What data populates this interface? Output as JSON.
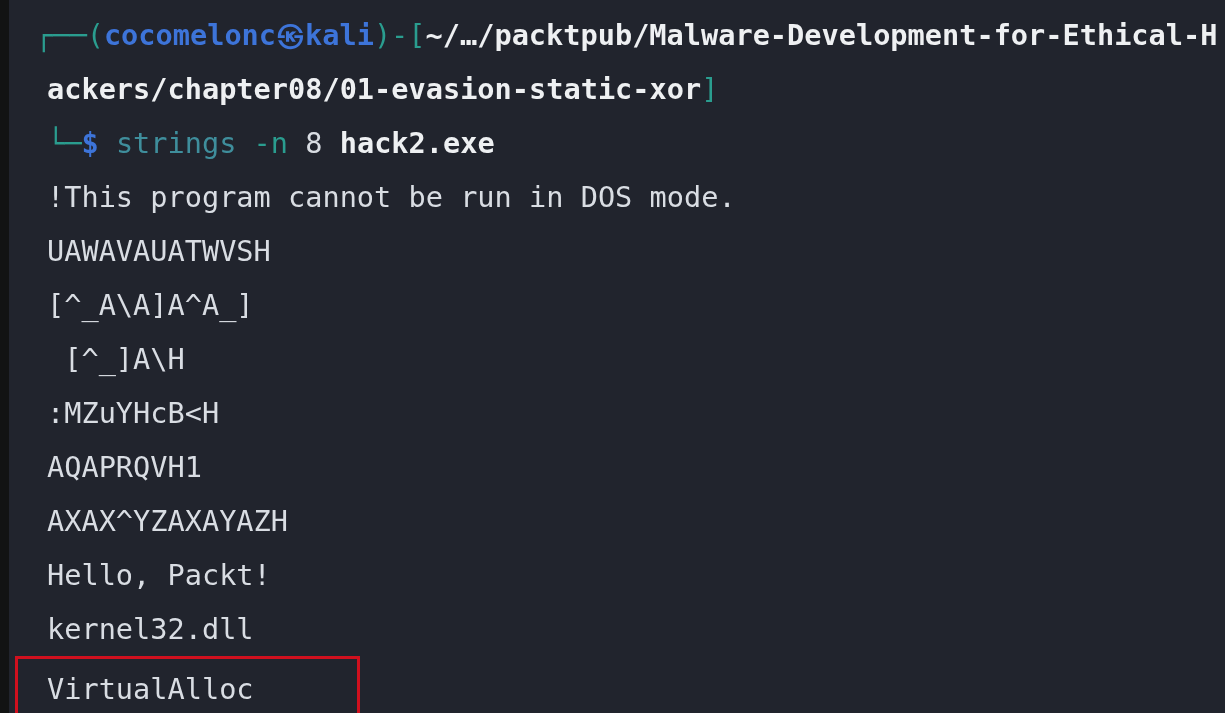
{
  "prompt": {
    "open": "┌──(",
    "user": "cocomelonc",
    "separator": "㉿",
    "host": "kali",
    "mid": ")-[",
    "path": "~/…/packtpub/Malware-Development-for-Ethical-H",
    "path_continued": "ackers/chapter08/01-evasion-static-xor",
    "close": "]"
  },
  "command": {
    "corner": "└─",
    "symbol": "$",
    "program": "strings",
    "flag": "-n",
    "value": "8",
    "argument": "hack2.exe"
  },
  "output": [
    {
      "text": "!This program cannot be run in DOS mode.",
      "highlighted": false
    },
    {
      "text": "UAWAVAUATWVSH",
      "highlighted": false
    },
    {
      "text": "[^_A\\A]A^A_]",
      "highlighted": false
    },
    {
      "text": " [^_]A\\H",
      "highlighted": false
    },
    {
      "text": ":MZuYHcB<H",
      "highlighted": false
    },
    {
      "text": "AQAPRQVH1",
      "highlighted": false
    },
    {
      "text": "AXAX^YZAXAYAZH",
      "highlighted": false
    },
    {
      "text": "Hello, Packt!",
      "highlighted": false
    },
    {
      "text": "kernel32.dll",
      "highlighted": false
    },
    {
      "text": "VirtualAlloc",
      "highlighted": true
    }
  ]
}
